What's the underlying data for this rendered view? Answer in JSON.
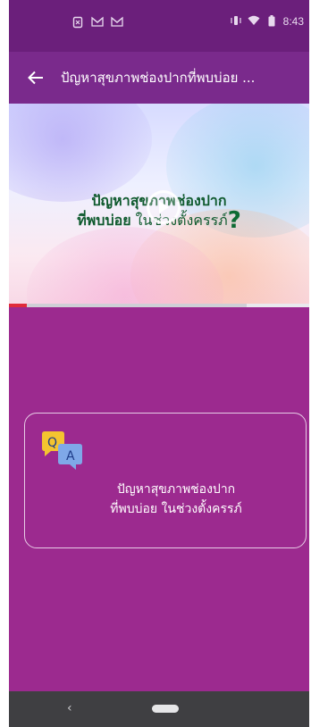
{
  "status_bar": {
    "icons": [
      "battery-saver-icon",
      "gmail-icon",
      "gmail-icon"
    ],
    "time": "8:43"
  },
  "app_bar": {
    "title": "ปัญหาสุขภาพช่องปากที่พบบ่อย ..."
  },
  "video": {
    "title_line1": "ปัญหาสุขภาพช่องปาก",
    "title_line2_bold": "ที่พบบ่อย",
    "title_line2_light": " ในช่วงตั้งครรภ์",
    "title_mark": "?",
    "progress": 0.06,
    "colors": {
      "title": "#0f5a2e",
      "progress": "#e02b3b"
    }
  },
  "card": {
    "icon": "qa-chat-bubbles-icon",
    "icon_letters": [
      "Q",
      "A"
    ],
    "line1": "ปัญหาสุขภาพช่องปาก",
    "line2": "ที่พบบ่อย ในช่วงตั้งครรภ์"
  },
  "nav_bar": {
    "back_glyph": "‹"
  },
  "colors": {
    "background": "#9c2a8f",
    "app_bar": "#7a2a8c",
    "status_bar": "#6b1f7b"
  }
}
